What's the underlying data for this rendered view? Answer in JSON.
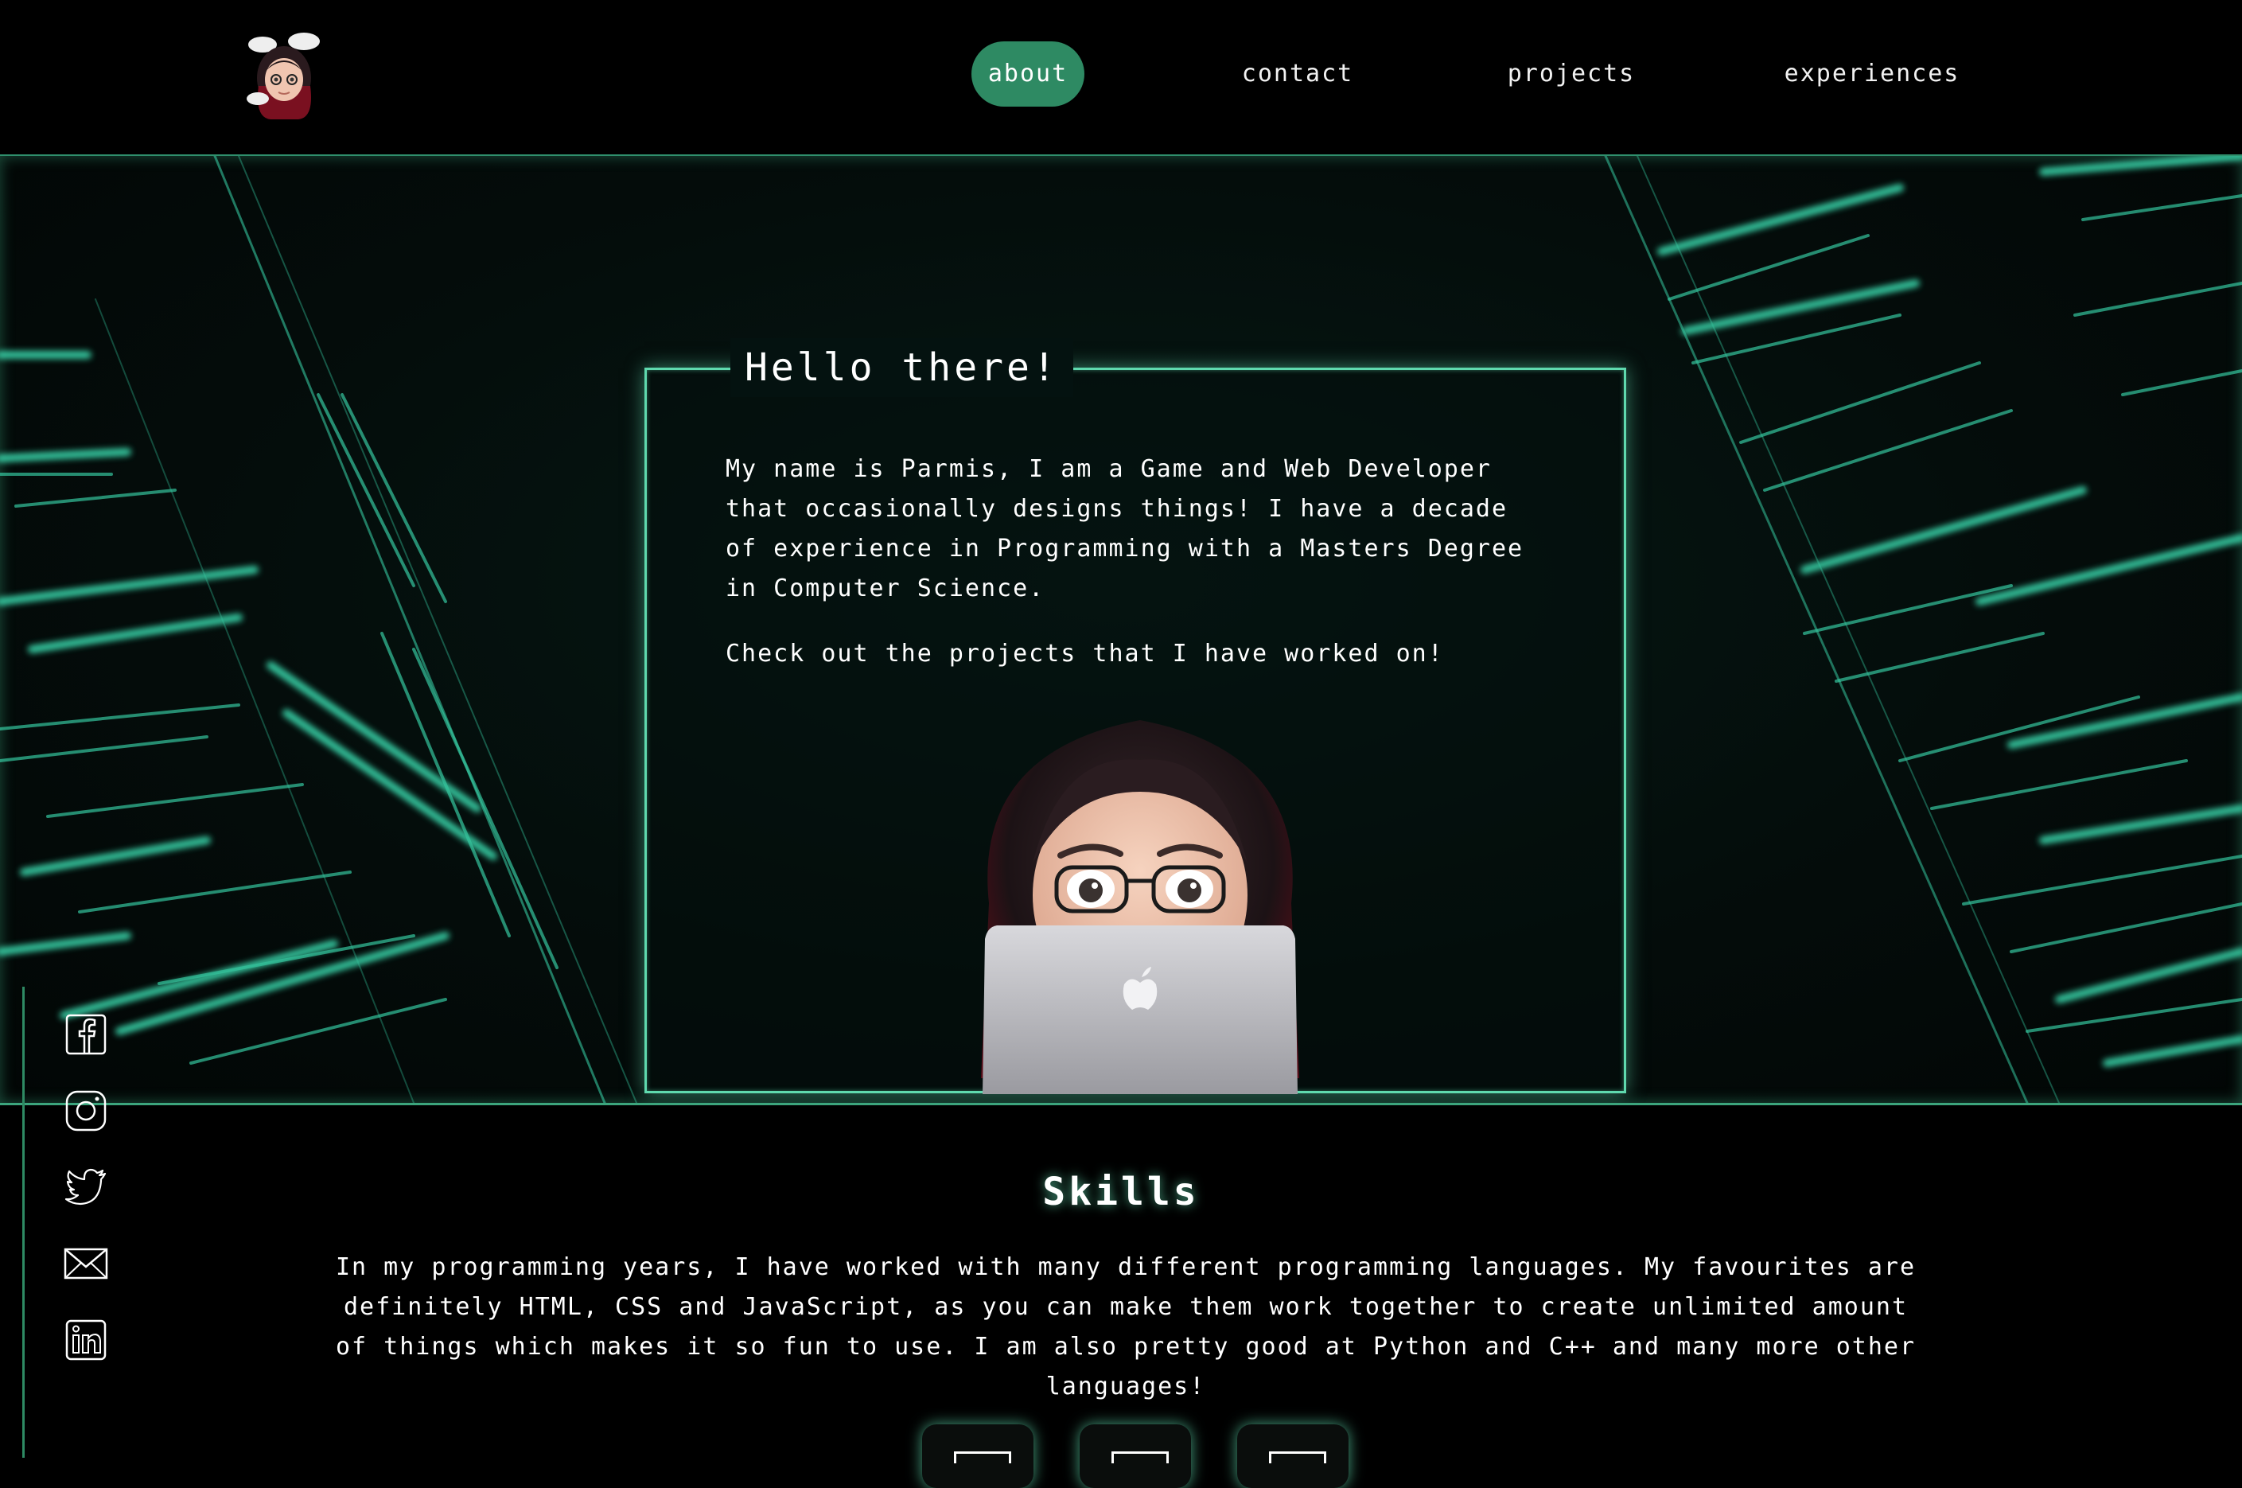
{
  "nav": {
    "items": [
      {
        "label": "about",
        "active": true
      },
      {
        "label": "contact",
        "active": false
      },
      {
        "label": "projects",
        "active": false
      },
      {
        "label": "experiences",
        "active": false
      }
    ]
  },
  "hero": {
    "title": "Hello there!",
    "paragraph1": "My name is Parmis, I am a Game and Web Developer that occasionally designs things! I have a decade of experience in Programming with a Masters Degree in Computer Science.",
    "paragraph2": "Check out the projects that I have worked on!"
  },
  "social": [
    {
      "icon": "facebook-icon"
    },
    {
      "icon": "instagram-icon"
    },
    {
      "icon": "twitter-icon"
    },
    {
      "icon": "email-icon"
    },
    {
      "icon": "linkedin-icon"
    }
  ],
  "skills": {
    "title": "Skills",
    "text": "In my programming years, I have worked with many different programming languages. My favourites are definitely HTML, CSS and JavaScript, as you can make them work together to create unlimited amount of things which makes it so fun to use. I am also pretty good at Python and C++ and many more other languages!"
  },
  "colors": {
    "accent": "#2e8a63",
    "glow": "#5fd9ae",
    "code": "#3ee6b8",
    "background": "#000000"
  }
}
